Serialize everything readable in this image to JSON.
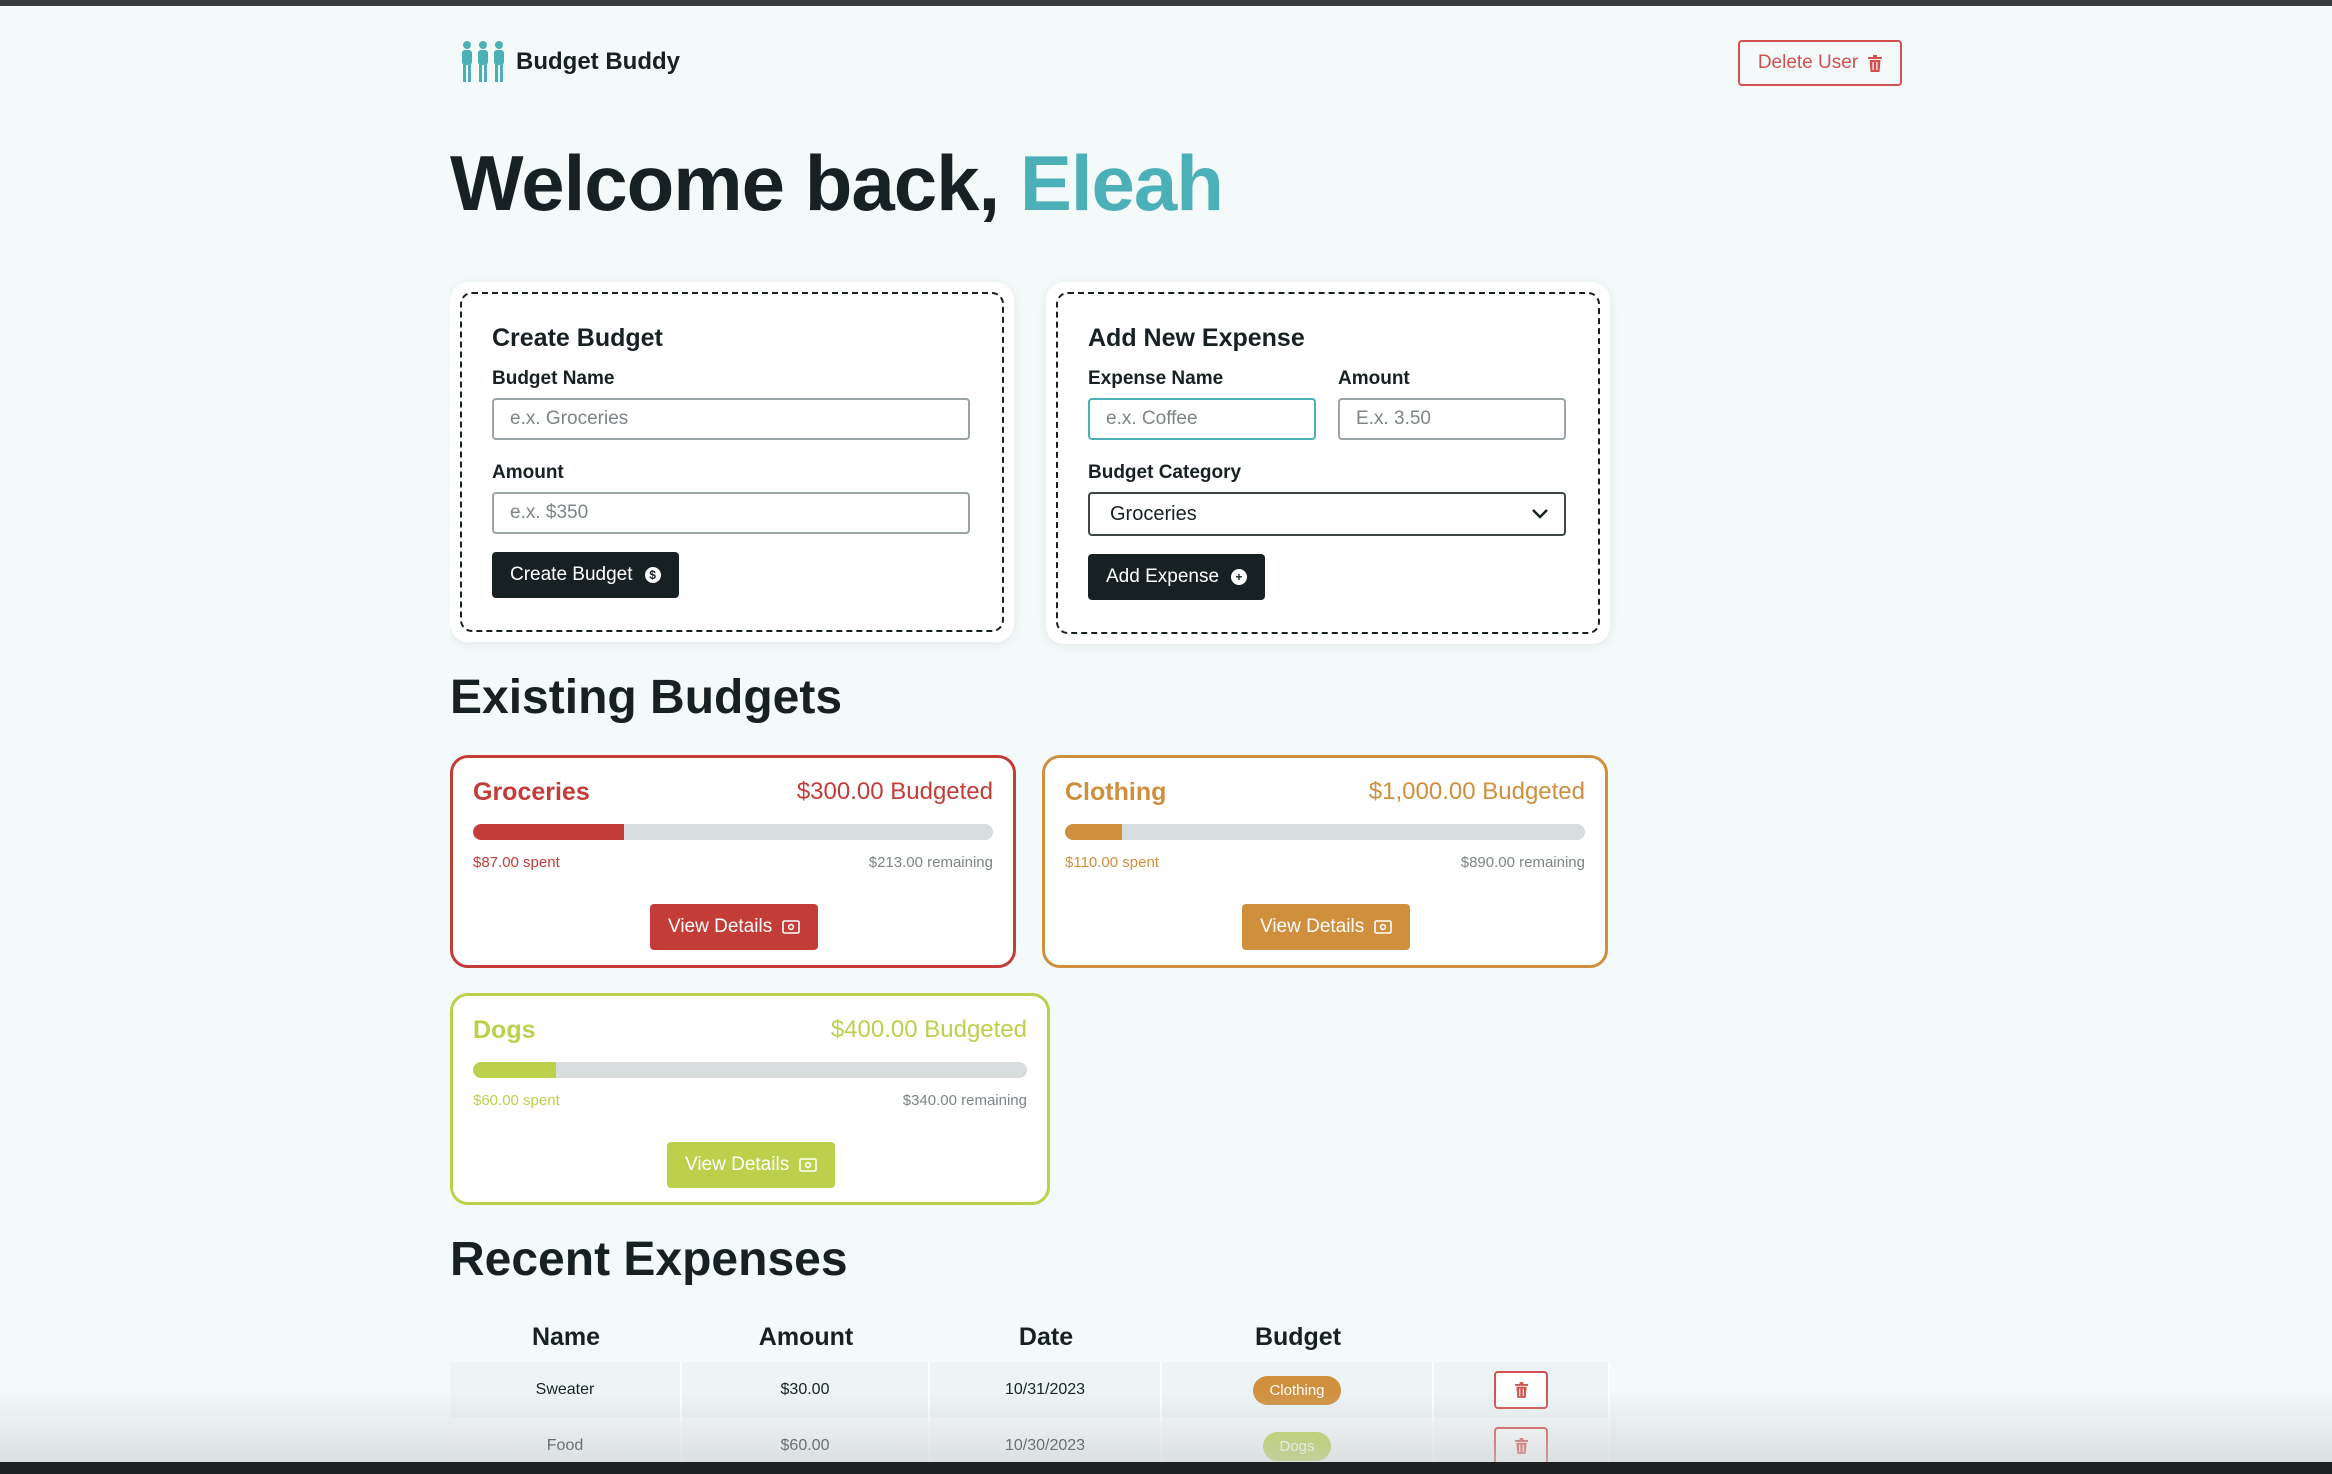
{
  "header": {
    "app_name": "Budget Buddy",
    "delete_user_label": "Delete User"
  },
  "welcome": {
    "prefix": "Welcome back,",
    "username": "Eleah"
  },
  "create_budget": {
    "title": "Create Budget",
    "name_label": "Budget Name",
    "name_placeholder": "e.x. Groceries",
    "amount_label": "Amount",
    "amount_placeholder": "e.x. $350",
    "button_label": "Create Budget"
  },
  "add_expense": {
    "title": "Add New Expense",
    "name_label": "Expense Name",
    "name_placeholder": "e.x. Coffee",
    "amount_label": "Amount",
    "amount_placeholder": "E.x. 3.50",
    "category_label": "Budget Category",
    "category_selected": "Groceries",
    "button_label": "Add Expense"
  },
  "existing_budgets": {
    "title": "Existing Budgets",
    "view_details_label": "View Details",
    "items": [
      {
        "name": "Groceries",
        "budgeted": "$300.00 Budgeted",
        "spent": "$87.00 spent",
        "remaining": "$213.00 remaining",
        "progress": 0.29,
        "color": "#c33c38"
      },
      {
        "name": "Clothing",
        "budgeted": "$1,000.00 Budgeted",
        "spent": "$110.00 spent",
        "remaining": "$890.00 remaining",
        "progress": 0.11,
        "color": "#d08f3c"
      },
      {
        "name": "Dogs",
        "budgeted": "$400.00 Budgeted",
        "spent": "$60.00 spent",
        "remaining": "$340.00 remaining",
        "progress": 0.15,
        "color": "#bcd04c"
      }
    ]
  },
  "recent_expenses": {
    "title": "Recent Expenses",
    "columns": [
      "Name",
      "Amount",
      "Date",
      "Budget"
    ],
    "rows": [
      {
        "name": "Sweater",
        "amount": "$30.00",
        "date": "10/31/2023",
        "budget": "Clothing",
        "color": "#d08f3c"
      },
      {
        "name": "Food",
        "amount": "$60.00",
        "date": "10/30/2023",
        "budget": "Dogs",
        "color": "#bcd04c"
      }
    ]
  }
}
